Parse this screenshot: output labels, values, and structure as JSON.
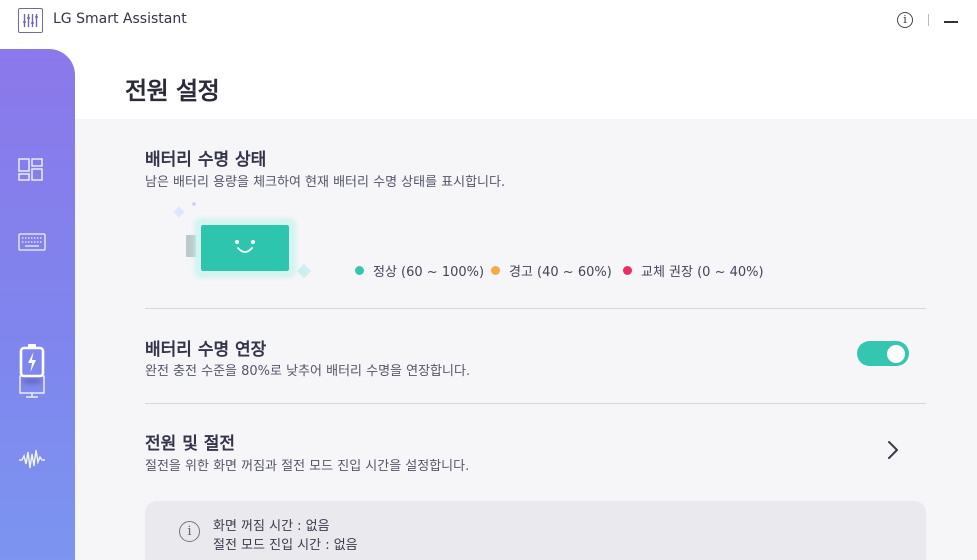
{
  "app": {
    "title": "LG Smart Assistant"
  },
  "titlebar": {
    "info_glyph": "i",
    "info_icon": "info-icon",
    "minimize_icon": "minimize-icon"
  },
  "sidebar": {
    "items": [
      {
        "icon": "dashboard-icon",
        "active": false
      },
      {
        "icon": "keyboard-icon",
        "active": false
      },
      {
        "icon": "battery-charging-icon",
        "active": true
      },
      {
        "icon": "monitor-icon",
        "active": false
      },
      {
        "icon": "audio-wave-icon",
        "active": false
      }
    ]
  },
  "page": {
    "title": "전원 설정"
  },
  "battery_health": {
    "title": "배터리 수명 상태",
    "description": "남은 배터리 용량을 체크하여 현재 배터리 수명 상태를 표시합니다.",
    "legend": [
      {
        "label": "정상 (60 ~ 100%)",
        "color": "#35c6b2"
      },
      {
        "label": "경고 (40 ~ 60%)",
        "color": "#f5a94a"
      },
      {
        "label": "교체 권장 (0 ~ 40%)",
        "color": "#ef2d62"
      }
    ]
  },
  "battery_extend": {
    "title": "배터리 수명 연장",
    "description": "완전 충전 수준을 80%로 낮추어 배터리 수명을 연장합니다.",
    "toggle_on": true
  },
  "power_saving": {
    "title": "전원 및 절전",
    "description": "절전을 위한 화면 꺼짐과 절전 모드 진입 시간을 설정합니다.",
    "info_glyph": "i",
    "info_lines": [
      "화면 꺼짐 시간  : 없음",
      "절전 모드 진입 시간  : 없음"
    ]
  },
  "colors": {
    "accent": "#35c6b2",
    "sidebar_top": "#8b78ea",
    "sidebar_bottom": "#7c95f0"
  }
}
